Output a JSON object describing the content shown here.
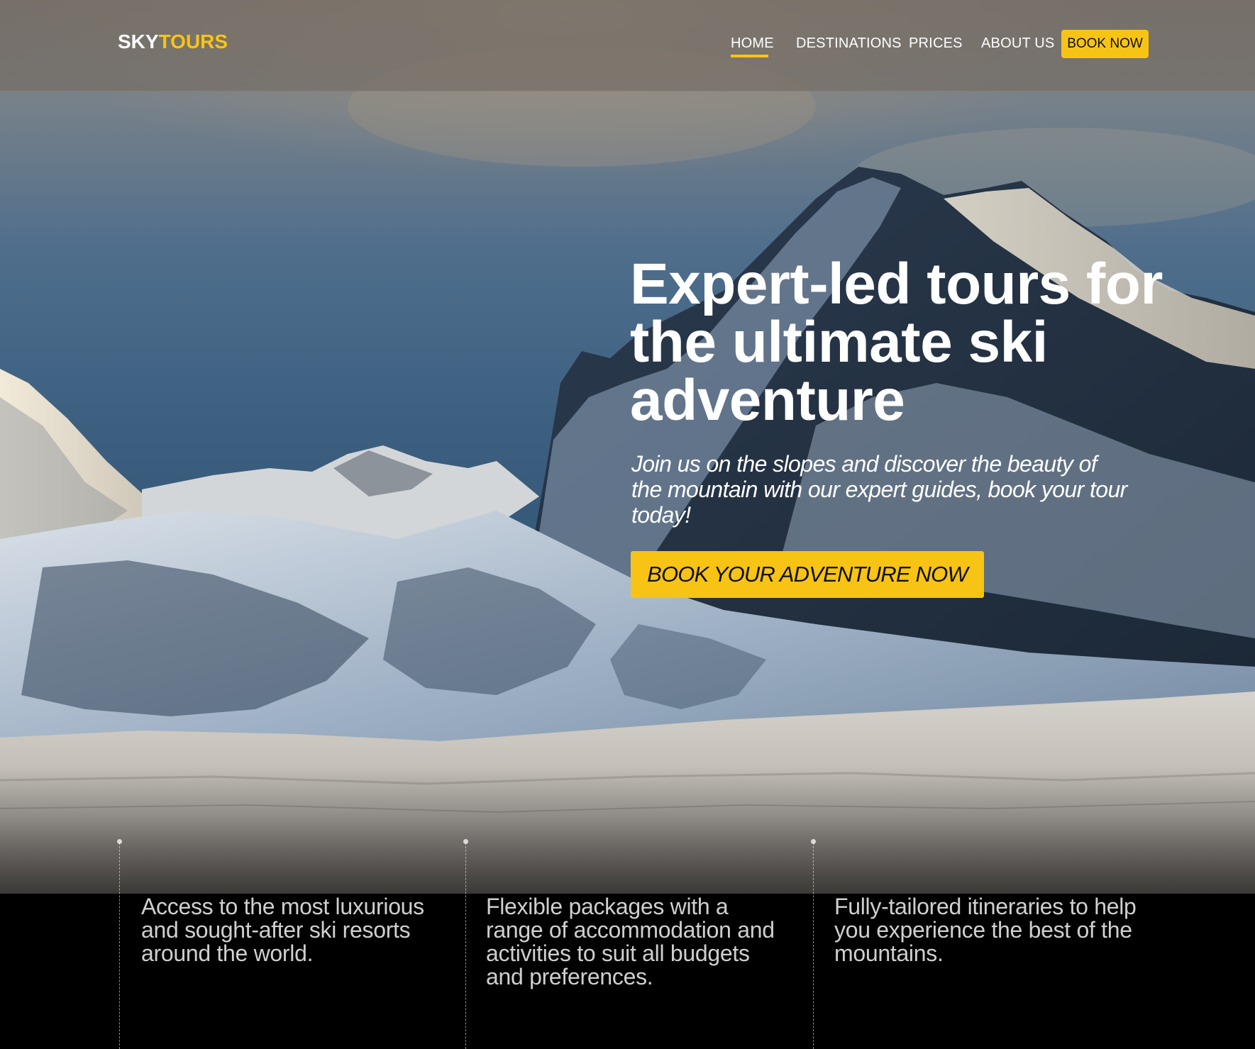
{
  "brand": {
    "logo_part1": "SKY",
    "logo_part2": "TOURS",
    "accent_color": "#f7c416"
  },
  "nav": {
    "items": [
      {
        "label": "HOME",
        "active": true
      },
      {
        "label": "DESTINATIONS",
        "active": false
      },
      {
        "label": "PRICES",
        "active": false
      },
      {
        "label": "ABOUT US",
        "active": false
      }
    ],
    "book_button_label": "BOOK NOW"
  },
  "hero": {
    "title": "Expert-led tours for the ultimate ski adventure",
    "subtitle": "Join us on the slopes and discover the beauty of the mountain with our expert guides, book your tour today!",
    "cta_label": "BOOK YOUR ADVENTURE NOW"
  },
  "features": [
    {
      "text": "Access to the most luxurious and sought-after ski resorts around the world."
    },
    {
      "text": "Flexible packages with a range of accommodation and activities to suit all budgets and preferences."
    },
    {
      "text": "Fully-tailored itineraries to help you experience the best of the mountains."
    }
  ]
}
